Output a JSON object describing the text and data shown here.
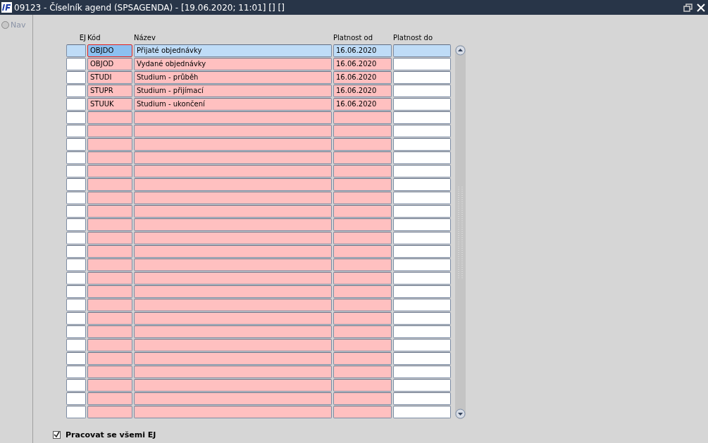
{
  "window": {
    "title": "09123 - Číselník agend (SPSAGENDA) - [19.06.2020; 11:01] [] []"
  },
  "sidebar": {
    "nav_label": "Nav",
    "nav_selected": false
  },
  "table": {
    "columns": [
      {
        "label": "EJ",
        "required": false
      },
      {
        "label": "Kód",
        "required": true
      },
      {
        "label": "Název",
        "required": true
      },
      {
        "label": "Platnost od",
        "required": true
      },
      {
        "label": "Platnost do",
        "required": false
      }
    ],
    "rows": [
      {
        "selected": true,
        "cells": [
          "",
          "OBJDO",
          "Přijaté objednávky",
          "16.06.2020",
          ""
        ]
      },
      {
        "selected": false,
        "cells": [
          "",
          "OBJOD",
          "Vydané objednávky",
          "16.06.2020",
          ""
        ]
      },
      {
        "selected": false,
        "cells": [
          "",
          "STUDI",
          "Studium - průběh",
          "16.06.2020",
          ""
        ]
      },
      {
        "selected": false,
        "cells": [
          "",
          "STUPR",
          "Studium - přijímací",
          "16.06.2020",
          ""
        ]
      },
      {
        "selected": false,
        "cells": [
          "",
          "STUUK",
          "Studium - ukončení",
          "16.06.2020",
          ""
        ]
      },
      {
        "selected": false
      },
      {
        "selected": false
      },
      {
        "selected": false
      },
      {
        "selected": false
      },
      {
        "selected": false
      },
      {
        "selected": false
      },
      {
        "selected": false
      },
      {
        "selected": false
      },
      {
        "selected": false
      },
      {
        "selected": false
      },
      {
        "selected": false
      },
      {
        "selected": false
      },
      {
        "selected": false
      },
      {
        "selected": false
      },
      {
        "selected": false
      },
      {
        "selected": false
      },
      {
        "selected": false
      },
      {
        "selected": false
      },
      {
        "selected": false
      },
      {
        "selected": false
      },
      {
        "selected": false
      },
      {
        "selected": false
      },
      {
        "selected": false
      }
    ]
  },
  "options": {
    "label": "Pracovat se všemi EJ",
    "checked": true
  }
}
